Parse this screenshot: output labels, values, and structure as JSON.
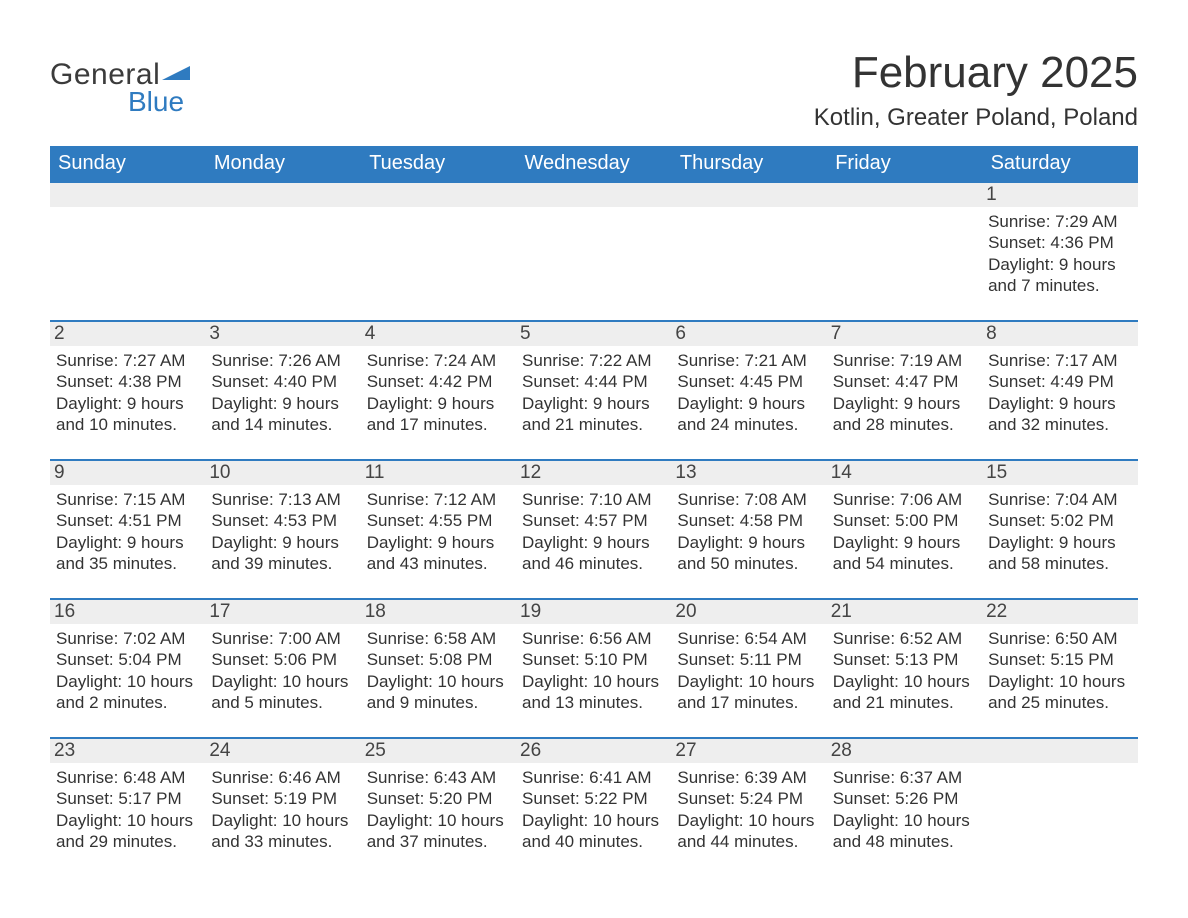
{
  "brand": {
    "general": "General",
    "blue": "Blue"
  },
  "title": "February 2025",
  "location": "Kotlin, Greater Poland, Poland",
  "weekdays": [
    "Sunday",
    "Monday",
    "Tuesday",
    "Wednesday",
    "Thursday",
    "Friday",
    "Saturday"
  ],
  "labels": {
    "sunrise": "Sunrise:",
    "sunset": "Sunset:",
    "daylight": "Daylight:"
  },
  "weeks": [
    [
      null,
      null,
      null,
      null,
      null,
      null,
      {
        "n": 1,
        "sunrise": "7:29 AM",
        "sunset": "4:36 PM",
        "daylight": "9 hours and 7 minutes."
      }
    ],
    [
      {
        "n": 2,
        "sunrise": "7:27 AM",
        "sunset": "4:38 PM",
        "daylight": "9 hours and 10 minutes."
      },
      {
        "n": 3,
        "sunrise": "7:26 AM",
        "sunset": "4:40 PM",
        "daylight": "9 hours and 14 minutes."
      },
      {
        "n": 4,
        "sunrise": "7:24 AM",
        "sunset": "4:42 PM",
        "daylight": "9 hours and 17 minutes."
      },
      {
        "n": 5,
        "sunrise": "7:22 AM",
        "sunset": "4:44 PM",
        "daylight": "9 hours and 21 minutes."
      },
      {
        "n": 6,
        "sunrise": "7:21 AM",
        "sunset": "4:45 PM",
        "daylight": "9 hours and 24 minutes."
      },
      {
        "n": 7,
        "sunrise": "7:19 AM",
        "sunset": "4:47 PM",
        "daylight": "9 hours and 28 minutes."
      },
      {
        "n": 8,
        "sunrise": "7:17 AM",
        "sunset": "4:49 PM",
        "daylight": "9 hours and 32 minutes."
      }
    ],
    [
      {
        "n": 9,
        "sunrise": "7:15 AM",
        "sunset": "4:51 PM",
        "daylight": "9 hours and 35 minutes."
      },
      {
        "n": 10,
        "sunrise": "7:13 AM",
        "sunset": "4:53 PM",
        "daylight": "9 hours and 39 minutes."
      },
      {
        "n": 11,
        "sunrise": "7:12 AM",
        "sunset": "4:55 PM",
        "daylight": "9 hours and 43 minutes."
      },
      {
        "n": 12,
        "sunrise": "7:10 AM",
        "sunset": "4:57 PM",
        "daylight": "9 hours and 46 minutes."
      },
      {
        "n": 13,
        "sunrise": "7:08 AM",
        "sunset": "4:58 PM",
        "daylight": "9 hours and 50 minutes."
      },
      {
        "n": 14,
        "sunrise": "7:06 AM",
        "sunset": "5:00 PM",
        "daylight": "9 hours and 54 minutes."
      },
      {
        "n": 15,
        "sunrise": "7:04 AM",
        "sunset": "5:02 PM",
        "daylight": "9 hours and 58 minutes."
      }
    ],
    [
      {
        "n": 16,
        "sunrise": "7:02 AM",
        "sunset": "5:04 PM",
        "daylight": "10 hours and 2 minutes."
      },
      {
        "n": 17,
        "sunrise": "7:00 AM",
        "sunset": "5:06 PM",
        "daylight": "10 hours and 5 minutes."
      },
      {
        "n": 18,
        "sunrise": "6:58 AM",
        "sunset": "5:08 PM",
        "daylight": "10 hours and 9 minutes."
      },
      {
        "n": 19,
        "sunrise": "6:56 AM",
        "sunset": "5:10 PM",
        "daylight": "10 hours and 13 minutes."
      },
      {
        "n": 20,
        "sunrise": "6:54 AM",
        "sunset": "5:11 PM",
        "daylight": "10 hours and 17 minutes."
      },
      {
        "n": 21,
        "sunrise": "6:52 AM",
        "sunset": "5:13 PM",
        "daylight": "10 hours and 21 minutes."
      },
      {
        "n": 22,
        "sunrise": "6:50 AM",
        "sunset": "5:15 PM",
        "daylight": "10 hours and 25 minutes."
      }
    ],
    [
      {
        "n": 23,
        "sunrise": "6:48 AM",
        "sunset": "5:17 PM",
        "daylight": "10 hours and 29 minutes."
      },
      {
        "n": 24,
        "sunrise": "6:46 AM",
        "sunset": "5:19 PM",
        "daylight": "10 hours and 33 minutes."
      },
      {
        "n": 25,
        "sunrise": "6:43 AM",
        "sunset": "5:20 PM",
        "daylight": "10 hours and 37 minutes."
      },
      {
        "n": 26,
        "sunrise": "6:41 AM",
        "sunset": "5:22 PM",
        "daylight": "10 hours and 40 minutes."
      },
      {
        "n": 27,
        "sunrise": "6:39 AM",
        "sunset": "5:24 PM",
        "daylight": "10 hours and 44 minutes."
      },
      {
        "n": 28,
        "sunrise": "6:37 AM",
        "sunset": "5:26 PM",
        "daylight": "10 hours and 48 minutes."
      },
      null
    ]
  ]
}
